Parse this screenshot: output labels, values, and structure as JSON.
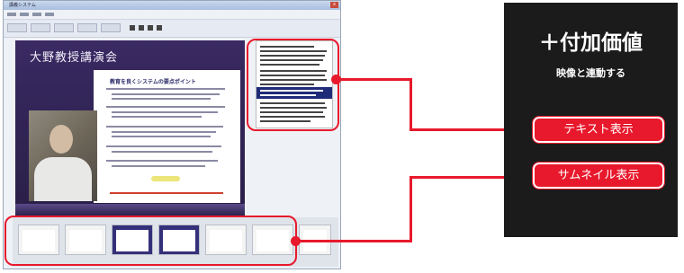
{
  "window": {
    "title": "講義システム",
    "close_label": "x"
  },
  "slide": {
    "title": "大野教授講演会",
    "heading": "教育を良くシステムの要点ポイント"
  },
  "right_panel": {
    "title": "＋付加価値",
    "subtitle": "映像と連動する"
  },
  "callouts": {
    "text_display": "テキスト表示",
    "thumbnail_display": "サムネイル表示"
  },
  "colors": {
    "accent_red": "#e8192c",
    "panel_black": "#1b1b1b"
  }
}
